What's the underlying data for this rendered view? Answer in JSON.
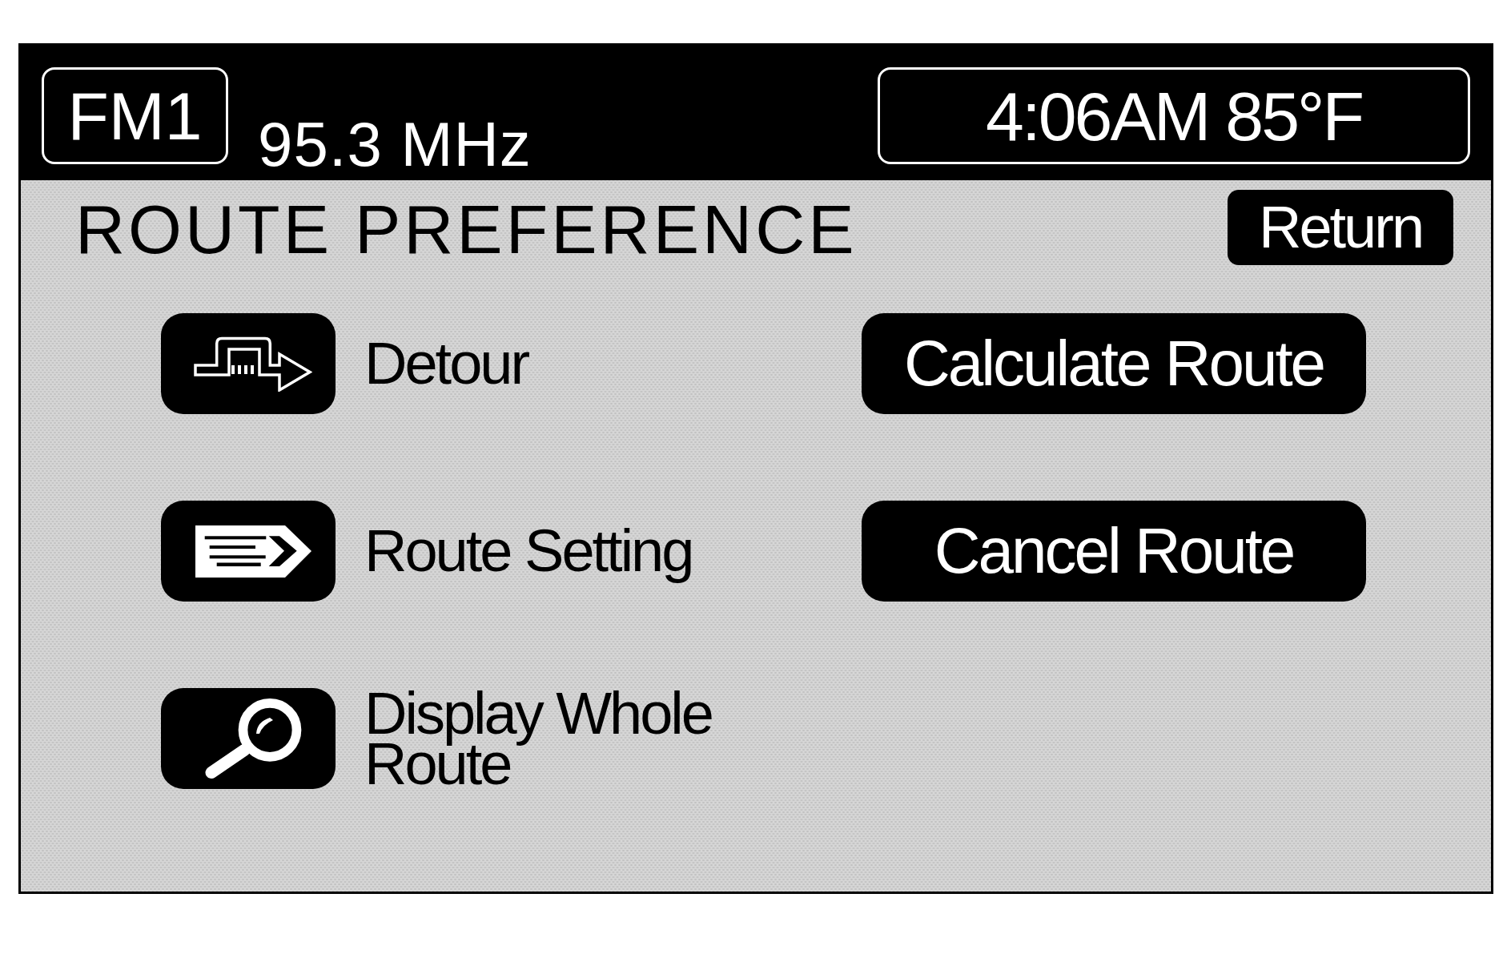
{
  "status_bar": {
    "band": "FM1",
    "frequency": "95.3 MHz",
    "clock": "4:06AM 85°F"
  },
  "header": {
    "title": "ROUTE PREFERENCE",
    "return_button": "Return"
  },
  "options": [
    {
      "kind": "detour",
      "label": "Detour"
    },
    {
      "kind": "route_setting",
      "label": "Route Setting"
    },
    {
      "kind": "display_whole_route",
      "label": "Display Whole Route"
    }
  ],
  "actions": [
    "Calculate Route",
    "Cancel Route"
  ]
}
